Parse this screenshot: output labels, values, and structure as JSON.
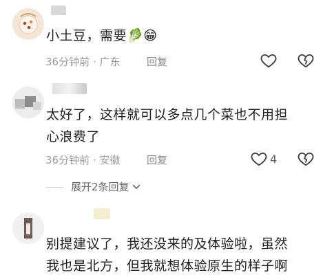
{
  "comments": [
    {
      "text": "小土豆，需要",
      "emoji": [
        "🥬",
        "😁"
      ],
      "time": "36分钟前",
      "location": "广东",
      "reply_label": "回复",
      "like_count": ""
    },
    {
      "text_line1": "太好了，这样就可以多点几个菜也不用担",
      "text_line2": "心浪费了",
      "time": "36分钟前",
      "location": "安徽",
      "reply_label": "回复",
      "like_count": "4",
      "expand_label": "展开2条回复"
    },
    {
      "text_line1": "别提建议了，我还没来的及体验啦，虽然",
      "text_line2": "我也是北方，但我就想体验原生的样子啊"
    }
  ],
  "separator": "·",
  "icons": {
    "like": "heart-icon",
    "dislike": "broken-heart-icon",
    "expand": "chevron-down-icon"
  },
  "colors": {
    "text": "#1f1f1f",
    "meta": "#9a9a9a",
    "icon": "#3a3a3a"
  }
}
